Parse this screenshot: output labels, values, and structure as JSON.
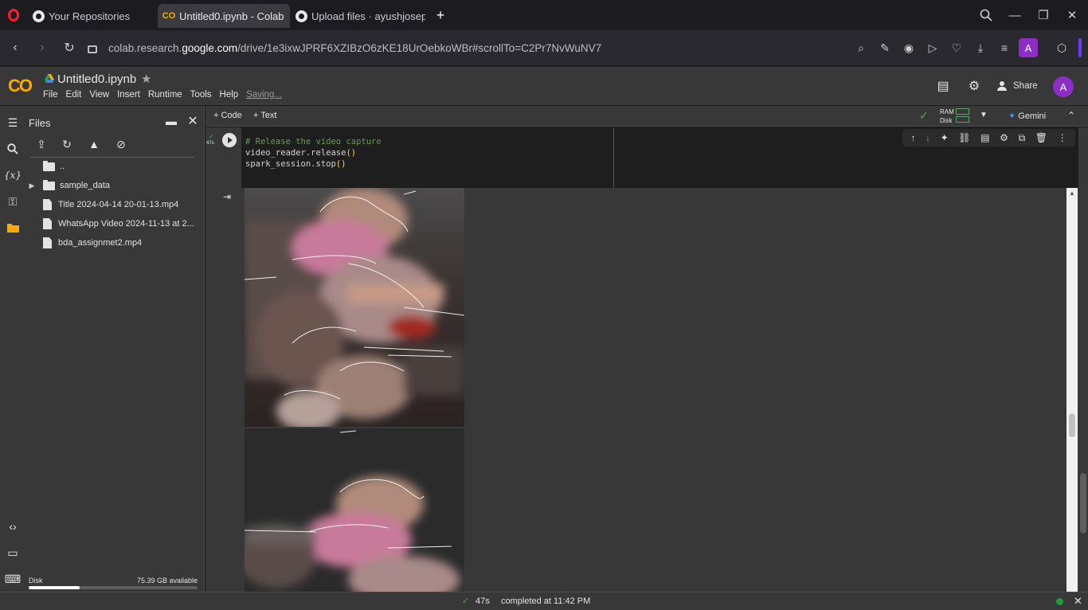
{
  "browser": {
    "tabs": [
      {
        "label": "Your Repositories"
      },
      {
        "label": "Untitled0.ipynb - Colab"
      },
      {
        "label": "Upload files · ayushjoseph"
      }
    ],
    "new_tab": "+",
    "url_prefix": "colab.research.",
    "url_domain": "google.com",
    "url_rest": "/drive/1e3ixwJPRF6XZIBzO6zKE18UrOebkoWBr#scrollTo=C2Pr7NvWuNV7",
    "profile_letter": "A"
  },
  "colab": {
    "logo": "CO",
    "notebook_title": "Untitled0.ipynb",
    "menu": [
      "File",
      "Edit",
      "View",
      "Insert",
      "Runtime",
      "Tools",
      "Help"
    ],
    "saving": "Saving...",
    "share_label": "Share",
    "avatar_letter": "A"
  },
  "files_panel": {
    "title": "Files",
    "parent": "..",
    "items": [
      {
        "name": "sample_data",
        "type": "folder"
      },
      {
        "name": "Title 2024-04-14 20-01-13.mp4",
        "type": "file"
      },
      {
        "name": "WhatsApp Video 2024-11-13 at 2...",
        "type": "file"
      },
      {
        "name": "bda_assignmet2.mp4",
        "type": "file"
      }
    ],
    "disk_label": "Disk",
    "disk_available": "75.39 GB available",
    "disk_used_fraction": 0.3
  },
  "toolbar": {
    "add_code": "Code",
    "add_text": "Text",
    "ram_label": "RAM",
    "disk_label": "Disk",
    "gemini_label": "Gemini"
  },
  "cell": {
    "exec_time": "47s",
    "code_comment": "# Release the video capture",
    "code_line2_a": "video_reader.release",
    "code_line2_b": "()",
    "code_line3_a": "spark_session.stop",
    "code_line3_b": "()"
  },
  "status": {
    "duration": "47s",
    "completed": "completed at 11:42 PM"
  },
  "colors": {
    "accent": "#f9ab00",
    "avatar": "#8e2dc5",
    "success": "#4caf50"
  }
}
